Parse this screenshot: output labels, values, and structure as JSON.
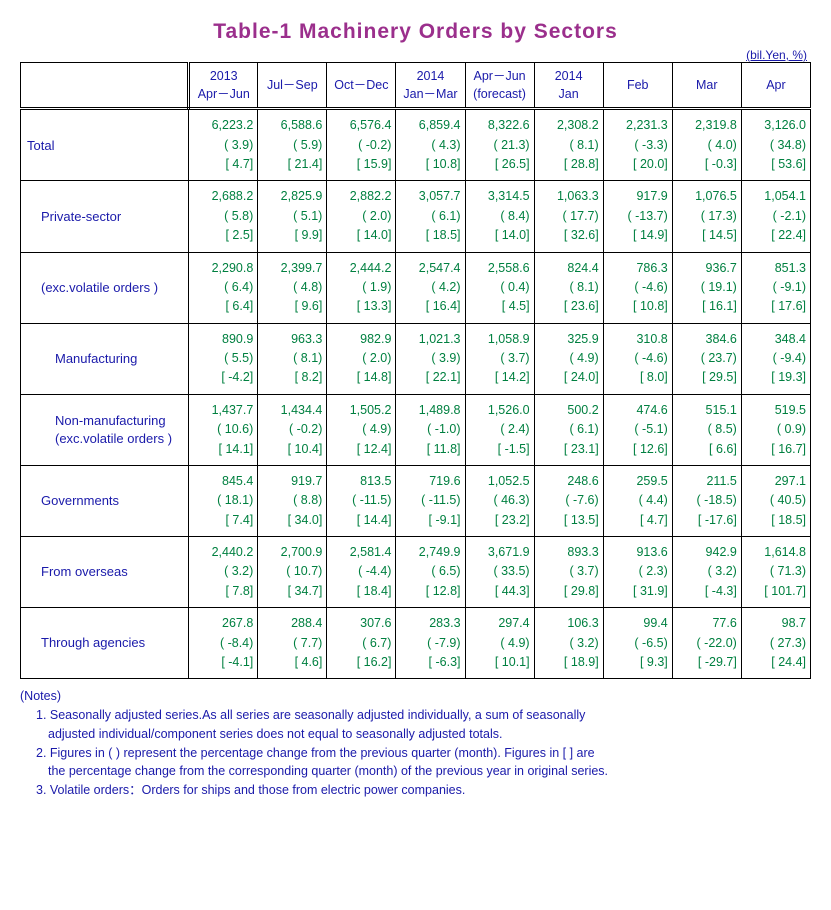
{
  "title": "Table-1   Machinery   Orders   by   Sectors",
  "unit": "(bil.Yen, %)",
  "periods": [
    {
      "y": "2013",
      "l": "Apr－Jun",
      "f": ""
    },
    {
      "y": "",
      "l": "Jul－Sep",
      "f": ""
    },
    {
      "y": "",
      "l": "Oct－Dec",
      "f": ""
    },
    {
      "y": "2014",
      "l": "Jan－Mar",
      "f": ""
    },
    {
      "y": "",
      "l": "Apr－Jun",
      "f": "(forecast)"
    },
    {
      "y": "2014",
      "l": "Jan",
      "f": ""
    },
    {
      "y": "",
      "l": "Feb",
      "f": ""
    },
    {
      "y": "",
      "l": "Mar",
      "f": ""
    },
    {
      "y": "",
      "l": "Apr",
      "f": ""
    }
  ],
  "rows": [
    {
      "id": "total",
      "indent": 0,
      "label": "Total",
      "label2": "",
      "v": [
        "6,223.2",
        "6,588.6",
        "6,576.4",
        "6,859.4",
        "8,322.6",
        "2,308.2",
        "2,231.3",
        "2,319.8",
        "3,126.0"
      ],
      "p": [
        "( 3.9)",
        "( 5.9)",
        "( -0.2)",
        "( 4.3)",
        "( 21.3)",
        "( 8.1)",
        "( -3.3)",
        "( 4.0)",
        "( 34.8)"
      ],
      "b": [
        "[ 4.7]",
        "[ 21.4]",
        "[ 15.9]",
        "[ 10.8]",
        "[ 26.5]",
        "[ 28.8]",
        "[ 20.0]",
        "[ -0.3]",
        "[ 53.6]"
      ]
    },
    {
      "id": "private",
      "indent": 1,
      "label": "Private-sector",
      "label2": "",
      "v": [
        "2,688.2",
        "2,825.9",
        "2,882.2",
        "3,057.7",
        "3,314.5",
        "1,063.3",
        "917.9",
        "1,076.5",
        "1,054.1"
      ],
      "p": [
        "( 5.8)",
        "( 5.1)",
        "( 2.0)",
        "( 6.1)",
        "( 8.4)",
        "( 17.7)",
        "( -13.7)",
        "( 17.3)",
        "( -2.1)"
      ],
      "b": [
        "[ 2.5]",
        "[ 9.9]",
        "[ 14.0]",
        "[ 18.5]",
        "[ 14.0]",
        "[ 32.6]",
        "[ 14.9]",
        "[ 14.5]",
        "[ 22.4]"
      ]
    },
    {
      "id": "excvol",
      "indent": 1,
      "label": "(exc.volatile orders )",
      "label2": "",
      "v": [
        "2,290.8",
        "2,399.7",
        "2,444.2",
        "2,547.4",
        "2,558.6",
        "824.4",
        "786.3",
        "936.7",
        "851.3"
      ],
      "p": [
        "( 6.4)",
        "( 4.8)",
        "( 1.9)",
        "( 4.2)",
        "( 0.4)",
        "( 8.1)",
        "( -4.6)",
        "( 19.1)",
        "( -9.1)"
      ],
      "b": [
        "[ 6.4]",
        "[ 9.6]",
        "[ 13.3]",
        "[ 16.4]",
        "[ 4.5]",
        "[ 23.6]",
        "[ 10.8]",
        "[ 16.1]",
        "[ 17.6]"
      ]
    },
    {
      "id": "mfg",
      "indent": 2,
      "label": "Manufacturing",
      "label2": "",
      "v": [
        "890.9",
        "963.3",
        "982.9",
        "1,021.3",
        "1,058.9",
        "325.9",
        "310.8",
        "384.6",
        "348.4"
      ],
      "p": [
        "( 5.5)",
        "( 8.1)",
        "( 2.0)",
        "( 3.9)",
        "( 3.7)",
        "( 4.9)",
        "( -4.6)",
        "( 23.7)",
        "( -9.4)"
      ],
      "b": [
        "[ -4.2]",
        "[ 8.2]",
        "[ 14.8]",
        "[ 22.1]",
        "[ 14.2]",
        "[ 24.0]",
        "[ 8.0]",
        "[ 29.5]",
        "[ 19.3]"
      ]
    },
    {
      "id": "nonmfg",
      "indent": 2,
      "label": "Non-manufacturing",
      "label2": "(exc.volatile orders )",
      "v": [
        "1,437.7",
        "1,434.4",
        "1,505.2",
        "1,489.8",
        "1,526.0",
        "500.2",
        "474.6",
        "515.1",
        "519.5"
      ],
      "p": [
        "( 10.6)",
        "( -0.2)",
        "( 4.9)",
        "( -1.0)",
        "( 2.4)",
        "( 6.1)",
        "( -5.1)",
        "( 8.5)",
        "( 0.9)"
      ],
      "b": [
        "[ 14.1]",
        "[ 10.4]",
        "[ 12.4]",
        "[ 11.8]",
        "[ -1.5]",
        "[ 23.1]",
        "[ 12.6]",
        "[ 6.6]",
        "[ 16.7]"
      ]
    },
    {
      "id": "gov",
      "indent": 1,
      "label": "Governments",
      "label2": "",
      "v": [
        "845.4",
        "919.7",
        "813.5",
        "719.6",
        "1,052.5",
        "248.6",
        "259.5",
        "211.5",
        "297.1"
      ],
      "p": [
        "( 18.1)",
        "( 8.8)",
        "( -11.5)",
        "( -11.5)",
        "( 46.3)",
        "( -7.6)",
        "( 4.4)",
        "( -18.5)",
        "( 40.5)"
      ],
      "b": [
        "[ 7.4]",
        "[ 34.0]",
        "[ 14.4]",
        "[ -9.1]",
        "[ 23.2]",
        "[ 13.5]",
        "[ 4.7]",
        "[ -17.6]",
        "[ 18.5]"
      ]
    },
    {
      "id": "overseas",
      "indent": 1,
      "label": "From overseas",
      "label2": "",
      "v": [
        "2,440.2",
        "2,700.9",
        "2,581.4",
        "2,749.9",
        "3,671.9",
        "893.3",
        "913.6",
        "942.9",
        "1,614.8"
      ],
      "p": [
        "( 3.2)",
        "( 10.7)",
        "( -4.4)",
        "( 6.5)",
        "( 33.5)",
        "( 3.7)",
        "( 2.3)",
        "( 3.2)",
        "( 71.3)"
      ],
      "b": [
        "[ 7.8]",
        "[ 34.7]",
        "[ 18.4]",
        "[ 12.8]",
        "[ 44.3]",
        "[ 29.8]",
        "[ 31.9]",
        "[ -4.3]",
        "[ 101.7]"
      ]
    },
    {
      "id": "agencies",
      "indent": 1,
      "label": "Through agencies",
      "label2": "",
      "v": [
        "267.8",
        "288.4",
        "307.6",
        "283.3",
        "297.4",
        "106.3",
        "99.4",
        "77.6",
        "98.7"
      ],
      "p": [
        "( -8.4)",
        "( 7.7)",
        "( 6.7)",
        "( -7.9)",
        "( 4.9)",
        "( 3.2)",
        "( -6.5)",
        "( -22.0)",
        "( 27.3)"
      ],
      "b": [
        "[ -4.1]",
        "[ 4.6]",
        "[ 16.2]",
        "[ -6.3]",
        "[ 10.1]",
        "[ 18.9]",
        "[ 9.3]",
        "[ -29.7]",
        "[ 24.4]"
      ]
    }
  ],
  "notes": {
    "head": "(Notes)",
    "n1a": "1. Seasonally adjusted series.As all series are seasonally adjusted individually, a sum of seasonally",
    "n1b": "adjusted individual/component series does not equal to seasonally adjusted totals.",
    "n2a": "2. Figures in ( ) represent the percentage change from the previous quarter (month). Figures in [ ] are",
    "n2b": "the percentage change from the corresponding quarter (month) of the previous year in original series.",
    "n3": "3. Volatile orders：Orders for ships and those from electric power companies."
  },
  "chart_data": {
    "type": "table",
    "title": "Machinery Orders by Sectors",
    "unit": "bil.Yen, %",
    "columns": [
      "2013 Apr-Jun",
      "Jul-Sep",
      "Oct-Dec",
      "2014 Jan-Mar",
      "Apr-Jun (forecast)",
      "2014 Jan",
      "Feb",
      "Mar",
      "Apr"
    ],
    "series": [
      {
        "name": "Total",
        "values": [
          6223.2,
          6588.6,
          6576.4,
          6859.4,
          8322.6,
          2308.2,
          2231.3,
          2319.8,
          3126.0
        ]
      },
      {
        "name": "Private-sector",
        "values": [
          2688.2,
          2825.9,
          2882.2,
          3057.7,
          3314.5,
          1063.3,
          917.9,
          1076.5,
          1054.1
        ]
      },
      {
        "name": "Private-sector exc. volatile",
        "values": [
          2290.8,
          2399.7,
          2444.2,
          2547.4,
          2558.6,
          824.4,
          786.3,
          936.7,
          851.3
        ]
      },
      {
        "name": "Manufacturing",
        "values": [
          890.9,
          963.3,
          982.9,
          1021.3,
          1058.9,
          325.9,
          310.8,
          384.6,
          348.4
        ]
      },
      {
        "name": "Non-manufacturing exc. volatile",
        "values": [
          1437.7,
          1434.4,
          1505.2,
          1489.8,
          1526.0,
          500.2,
          474.6,
          515.1,
          519.5
        ]
      },
      {
        "name": "Governments",
        "values": [
          845.4,
          919.7,
          813.5,
          719.6,
          1052.5,
          248.6,
          259.5,
          211.5,
          297.1
        ]
      },
      {
        "name": "From overseas",
        "values": [
          2440.2,
          2700.9,
          2581.4,
          2749.9,
          3671.9,
          893.3,
          913.6,
          942.9,
          1614.8
        ]
      },
      {
        "name": "Through agencies",
        "values": [
          267.8,
          288.4,
          307.6,
          283.3,
          297.4,
          106.3,
          99.4,
          77.6,
          98.7
        ]
      }
    ]
  }
}
